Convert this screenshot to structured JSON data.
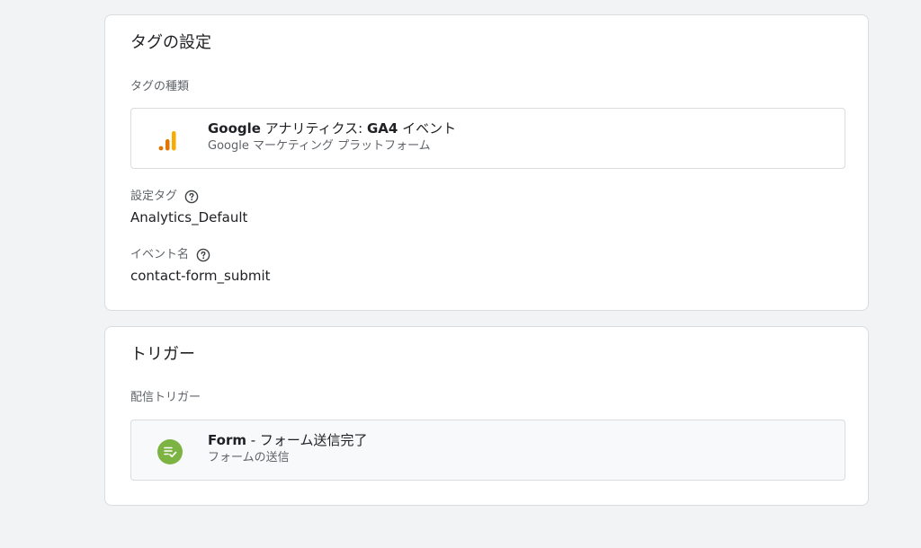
{
  "tag_config": {
    "title": "タグの設定",
    "tag_type_label": "タグの種類",
    "tag_type": {
      "name_bold": "Google",
      "name_rest": " アナリティクス: ",
      "name_bold2": "GA4",
      "name_rest2": " イベント",
      "subtitle": "Google マーケティング プラットフォーム",
      "icon": "ga4-analytics-icon"
    },
    "config_tag_label": "設定タグ",
    "config_tag_value": "Analytics_Default",
    "event_name_label": "イベント名",
    "event_name_value": "contact-form_submit"
  },
  "trigger": {
    "title": "トリガー",
    "firing_label": "配信トリガー",
    "item": {
      "name_bold": "Form",
      "name_rest": " - フォーム送信完了",
      "subtitle": "フォームの送信",
      "icon": "form-submit-icon"
    }
  },
  "colors": {
    "ga_orange": "#f9ab00",
    "ga_dark_orange": "#e37400",
    "trigger_green": "#7cb342"
  }
}
